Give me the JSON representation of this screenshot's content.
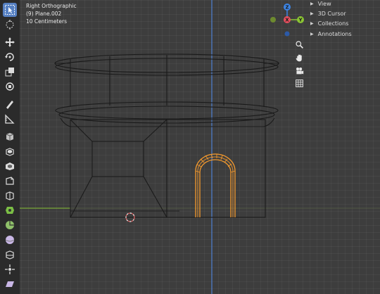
{
  "overlay": {
    "view_name": "Right Orthographic",
    "object_name": "(9) Plane.002",
    "grid_scale": "10 Centimeters"
  },
  "toolbar": {
    "tools": [
      "select-box",
      "cursor",
      "move",
      "rotate",
      "scale",
      "transform",
      "annotate",
      "measure",
      "add-cube",
      "extrude-region",
      "inset-faces",
      "bevel",
      "loop-cut",
      "knife",
      "poly-build",
      "spin",
      "smooth",
      "edge-slide",
      "shrink-fatten",
      "shear",
      "rip-region"
    ],
    "active_tool": "select-box"
  },
  "gizmo": {
    "z_label": "Z",
    "x_label": "X",
    "y_label": "Y",
    "colors": {
      "x": "#e84f5e",
      "y": "#8bc534",
      "z": "#3d85e6"
    }
  },
  "navigation": {
    "buttons": [
      "zoom-icon",
      "hand-pan-icon",
      "camera-icon",
      "grid-toggle-icon"
    ]
  },
  "side_panel": {
    "items": [
      {
        "label": "View"
      },
      {
        "label": "3D Cursor"
      },
      {
        "label": "Collections"
      },
      {
        "label": "Annotations"
      }
    ]
  },
  "colors": {
    "viewport_bg": "#3d3d3d",
    "wire": "#1a1a1a",
    "selected_wire": "#f59a2d",
    "axis_green": "#7aa83a",
    "axis_blue": "#4d7ecf",
    "active_tool": "#5680c2"
  }
}
